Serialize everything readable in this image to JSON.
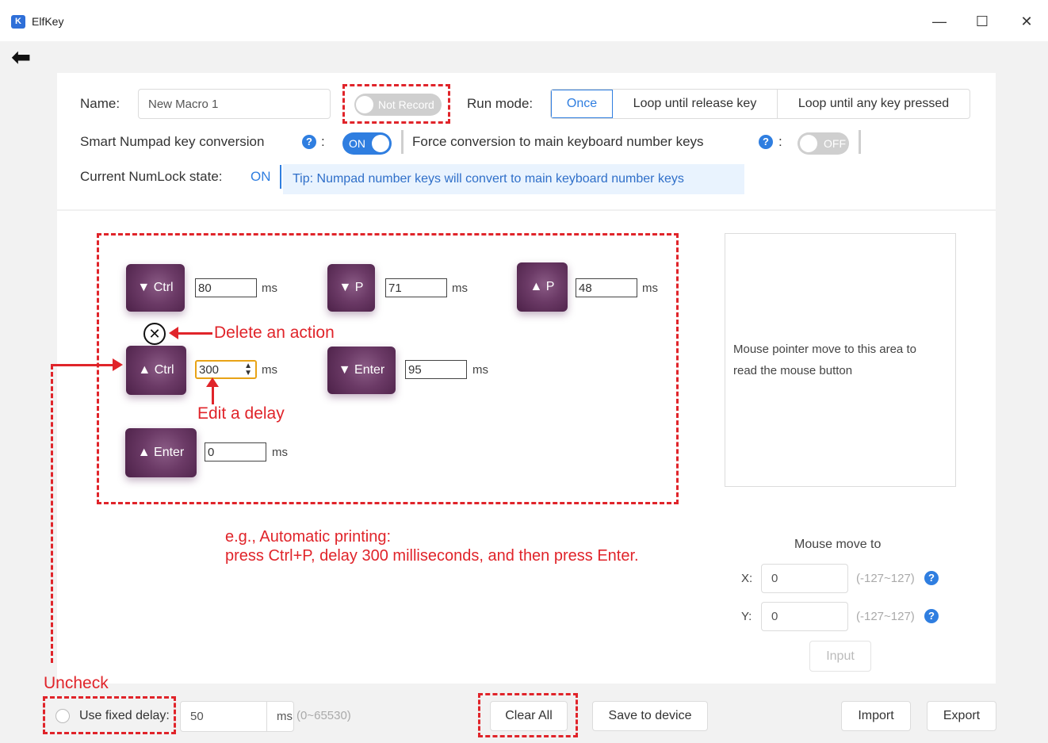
{
  "window": {
    "title": "ElfKey",
    "logo_text": "K",
    "minimize": "—",
    "maximize": "☐",
    "close": "✕"
  },
  "back_icon": "back-arrow-icon",
  "header": {
    "name_label": "Name:",
    "name_value": "New Macro 1",
    "record_toggle": "Not Record",
    "run_mode_label": "Run mode:",
    "run_modes": [
      "Once",
      "Loop until release key",
      "Loop until any key pressed"
    ],
    "run_mode_selected": "Once",
    "smart_numpad_label": "Smart Numpad key conversion",
    "smart_numpad_toggle": "ON",
    "force_label": "Force conversion to main keyboard number keys",
    "force_toggle": "OFF",
    "numlock_label": "Current NumLock state:",
    "numlock_value": "ON",
    "tip": "Tip: Numpad number keys will convert to main keyboard number keys",
    "help_glyph": "?",
    "colon": ":"
  },
  "actions": [
    {
      "key": "Ctrl",
      "direction": "down",
      "delay": "80"
    },
    {
      "key": "P",
      "direction": "down",
      "delay": "71"
    },
    {
      "key": "P",
      "direction": "up",
      "delay": "48"
    },
    {
      "key": "Ctrl",
      "direction": "up",
      "delay": "300"
    },
    {
      "key": "Enter",
      "direction": "down",
      "delay": "95"
    },
    {
      "key": "Enter",
      "direction": "up",
      "delay": "0"
    }
  ],
  "ms_unit": "ms",
  "annotations": {
    "delete": "Delete an action",
    "edit": "Edit a delay",
    "example_line1": "e.g., Automatic printing:",
    "example_line2": "press Ctrl+P, delay 300 milliseconds, and then press Enter.",
    "uncheck": "Uncheck"
  },
  "mouse": {
    "area_text_line1": "Mouse pointer move to this area to",
    "area_text_line2": "read the mouse button",
    "move_to_label": "Mouse move to",
    "x_label": "X:",
    "x_value": "0",
    "x_range": "(-127~127)",
    "y_label": "Y:",
    "y_value": "0",
    "y_range": "(-127~127)",
    "input_button": "Input"
  },
  "footer": {
    "fixed_delay_label": "Use fixed delay:",
    "fixed_delay_value": "50",
    "fixed_delay_unit": "ms",
    "fixed_delay_range": "(0~65530)",
    "clear_all": "Clear All",
    "save_device": "Save to device",
    "import": "Import",
    "export": "Export"
  },
  "colors": {
    "accent": "#2f7ee0",
    "annotation_red": "#e0242a",
    "key_purple": "#6b3a66"
  }
}
